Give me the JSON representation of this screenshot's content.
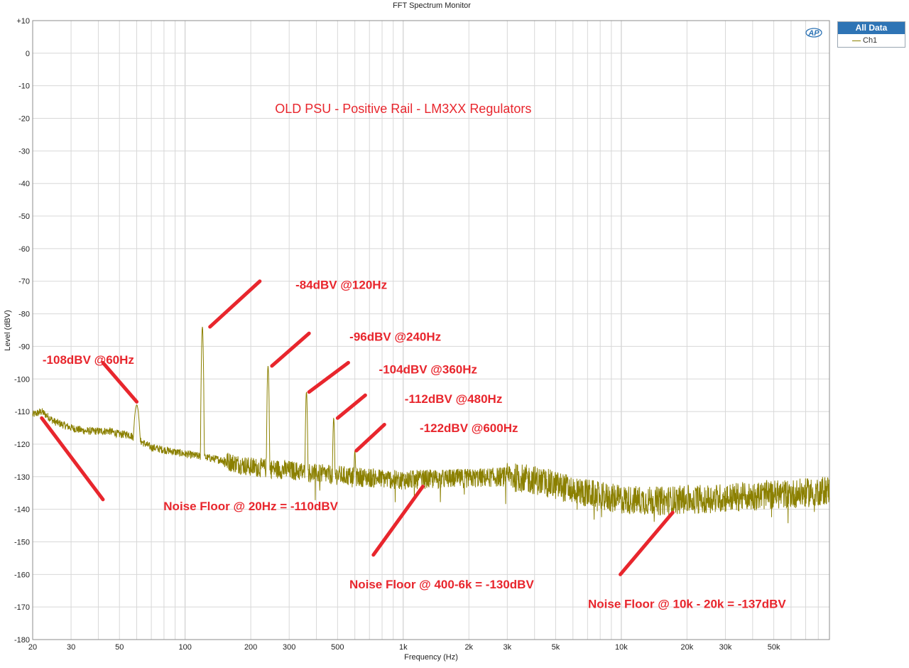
{
  "window": {
    "title": "FFT Spectrum Monitor"
  },
  "legend": {
    "header": "All Data",
    "entry": "Ch1"
  },
  "logo": {
    "text": "AP"
  },
  "colors": {
    "trace": "#8b8000",
    "annotation": "#e8262d",
    "legend_header": "#2e74b5",
    "grid": "#d8d8d8"
  },
  "chart_data": {
    "type": "line",
    "title": "FFT Spectrum Monitor",
    "xlabel": "Frequency (Hz)",
    "ylabel": "Level (dBV)",
    "xscale": "log",
    "xlim": [
      20,
      90000
    ],
    "ylim": [
      -180,
      10
    ],
    "grid": true,
    "legend_position": "top-right",
    "x_ticks": [
      {
        "v": 20,
        "label": "20"
      },
      {
        "v": 30,
        "label": "30"
      },
      {
        "v": 50,
        "label": "50"
      },
      {
        "v": 100,
        "label": "100"
      },
      {
        "v": 200,
        "label": "200"
      },
      {
        "v": 300,
        "label": "300"
      },
      {
        "v": 500,
        "label": "500"
      },
      {
        "v": 1000,
        "label": "1k"
      },
      {
        "v": 2000,
        "label": "2k"
      },
      {
        "v": 3000,
        "label": "3k"
      },
      {
        "v": 5000,
        "label": "5k"
      },
      {
        "v": 10000,
        "label": "10k"
      },
      {
        "v": 20000,
        "label": "20k"
      },
      {
        "v": 30000,
        "label": "30k"
      },
      {
        "v": 50000,
        "label": "50k"
      }
    ],
    "y_ticks": [
      {
        "v": 10,
        "label": "+10"
      },
      {
        "v": 0,
        "label": "0"
      },
      {
        "v": -10,
        "label": "-10"
      },
      {
        "v": -20,
        "label": "-20"
      },
      {
        "v": -30,
        "label": "-30"
      },
      {
        "v": -40,
        "label": "-40"
      },
      {
        "v": -50,
        "label": "-50"
      },
      {
        "v": -60,
        "label": "-60"
      },
      {
        "v": -70,
        "label": "-70"
      },
      {
        "v": -80,
        "label": "-80"
      },
      {
        "v": -90,
        "label": "-90"
      },
      {
        "v": -100,
        "label": "-100"
      },
      {
        "v": -110,
        "label": "-110"
      },
      {
        "v": -120,
        "label": "-120"
      },
      {
        "v": -130,
        "label": "-130"
      },
      {
        "v": -140,
        "label": "-140"
      },
      {
        "v": -150,
        "label": "-150"
      },
      {
        "v": -160,
        "label": "-160"
      },
      {
        "v": -170,
        "label": "-170"
      },
      {
        "v": -180,
        "label": "-180"
      }
    ],
    "series": [
      {
        "name": "Ch1",
        "color": "#8b8000",
        "baseline": [
          [
            20,
            -111
          ],
          [
            22,
            -110
          ],
          [
            25,
            -113
          ],
          [
            30,
            -115
          ],
          [
            35,
            -116
          ],
          [
            40,
            -116
          ],
          [
            45,
            -116
          ],
          [
            50,
            -117
          ],
          [
            55,
            -117
          ],
          [
            70,
            -121
          ],
          [
            100,
            -123
          ],
          [
            150,
            -125
          ],
          [
            200,
            -127
          ],
          [
            300,
            -128
          ],
          [
            400,
            -129
          ],
          [
            600,
            -130
          ],
          [
            1000,
            -131
          ],
          [
            2000,
            -130.5
          ],
          [
            3000,
            -130
          ],
          [
            4000,
            -131
          ],
          [
            6000,
            -134
          ],
          [
            8000,
            -136
          ],
          [
            10000,
            -137
          ],
          [
            15000,
            -137.5
          ],
          [
            20000,
            -137
          ],
          [
            30000,
            -136.5
          ],
          [
            50000,
            -135.5
          ],
          [
            70000,
            -135
          ],
          [
            90000,
            -134
          ]
        ],
        "peaks": [
          {
            "f": 60,
            "level": -108
          },
          {
            "f": 120,
            "level": -84
          },
          {
            "f": 240,
            "level": -96
          },
          {
            "f": 360,
            "level": -104
          },
          {
            "f": 480,
            "level": -112
          },
          {
            "f": 600,
            "level": -122
          }
        ]
      }
    ],
    "annotations": [
      {
        "text": "OLD PSU - Positive Rail - LM3XX Regulators",
        "x": 1000,
        "y": -17,
        "style": "title"
      },
      {
        "text": "-84dBV @120Hz",
        "x": 520,
        "y": -71,
        "line": [
          [
            130,
            -84
          ],
          [
            220,
            -70
          ]
        ]
      },
      {
        "text": "-96dBV @240Hz",
        "x": 920,
        "y": -87,
        "line": [
          [
            250,
            -96
          ],
          [
            370,
            -86
          ]
        ]
      },
      {
        "text": "-104dBV @360Hz",
        "x": 1300,
        "y": -97,
        "line": [
          [
            370,
            -104
          ],
          [
            560,
            -95
          ]
        ]
      },
      {
        "text": "-112dBV @480Hz",
        "x": 1700,
        "y": -106,
        "line": [
          [
            500,
            -112
          ],
          [
            670,
            -105
          ]
        ]
      },
      {
        "text": "-122dBV @600Hz",
        "x": 2000,
        "y": -115,
        "line": [
          [
            610,
            -122
          ],
          [
            820,
            -114
          ]
        ]
      },
      {
        "text": "-108dBV @60Hz",
        "x": 36,
        "y": -94,
        "line": [
          [
            42,
            -95
          ],
          [
            60,
            -107
          ]
        ]
      },
      {
        "text": "Noise Floor @ 20Hz = -110dBV",
        "x": 200,
        "y": -139,
        "line": [
          [
            22,
            -112
          ],
          [
            42,
            -137
          ]
        ]
      },
      {
        "text": "Noise Floor @ 400-6k = -130dBV",
        "x": 1500,
        "y": -163,
        "line": [
          [
            730,
            -154
          ],
          [
            1230,
            -133
          ]
        ]
      },
      {
        "text": "Noise Floor @ 10k - 20k = -137dBV",
        "x": 20000,
        "y": -169,
        "line": [
          [
            9900,
            -160
          ],
          [
            17200,
            -141
          ]
        ]
      }
    ]
  }
}
